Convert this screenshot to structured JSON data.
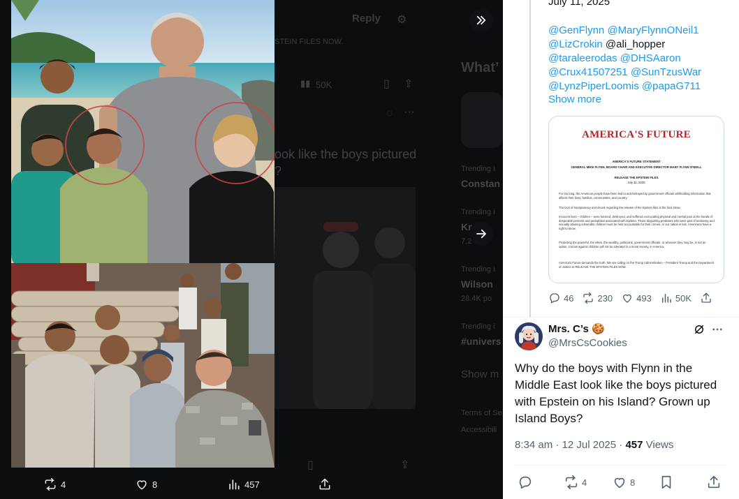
{
  "background": {
    "reply_button": "Reply",
    "epstein_text": "STEIN FILES NOW.",
    "views": "50K",
    "tweet_text_line1": "ook like the boys pictured",
    "tweet_text_line2": "?",
    "sidebar_heading": "What’",
    "trends": [
      {
        "context": "Trending i",
        "name": "Constan",
        "count": ""
      },
      {
        "context": "Trending i",
        "name": "Kr",
        "count": "7,2"
      },
      {
        "context": "Trending i",
        "name": "Wilson",
        "count": "28.4K po"
      },
      {
        "context": "Trending i",
        "name": "#univers",
        "count": ""
      }
    ],
    "show_more": "Show m",
    "footer1": "Terms of Se",
    "footer2": "Accessibili"
  },
  "media_actions": {
    "retweets": "4",
    "likes": "8",
    "views": "457"
  },
  "panel": {
    "date": "July 11, 2025",
    "mentions": [
      {
        "text": "@GenFlynn",
        "link": true
      },
      {
        "text": " ",
        "link": false
      },
      {
        "text": "@MaryFlynnONeil1",
        "link": true
      },
      {
        "text": " ",
        "link": false
      },
      {
        "text": "@LizCrokin",
        "link": true
      },
      {
        "text": " @ali_hopper ",
        "link": false
      },
      {
        "text": "@taraleerodas",
        "link": true
      },
      {
        "text": " ",
        "link": false
      },
      {
        "text": "@DHSAaron",
        "link": true
      },
      {
        "text": " ",
        "link": false
      },
      {
        "text": "@Crux41507251",
        "link": true
      },
      {
        "text": " ",
        "link": false
      },
      {
        "text": "@SunTzusWar",
        "link": true
      },
      {
        "text": " ",
        "link": false
      },
      {
        "text": "@LynzPiperLoomis",
        "link": true
      },
      {
        "text": " ",
        "link": false
      },
      {
        "text": "@papaG711",
        "link": true
      }
    ],
    "show_more": "Show more",
    "doc": {
      "title": "AMERICA'S FUTURE",
      "statement": "AMERICA'S FUTURE STATEMENT",
      "byline": "GENERAL MIKE FLYNN, BOARD CHAIR AND EXECUTIVE DIRECTOR MARY FLYNN O'NEILL",
      "headline": "RELEASE THE EPSTEIN FILES",
      "date": "July 11, 2025",
      "paragraphs": [
        "For too long, the American people have been lied to and betrayed by government officials withholding information that affects their lives, families, communities, and country.",
        "The lack of transparency and deceit regarding the release of the Epstein files is the final straw.",
        "Innocent lives – children – were harmed, destroyed, and suffered excruciating physical and mental pain at the hands of despicable perverts and pedophiles associated with Epstein. Those disgusting predators who were part of enslaving and sexually abusing vulnerable children must be held accountable for their crimes, or our nation is lost. Americans have a right to know.",
        "Protecting the powerful, the elites, the wealthy, politicians, government officials, or whoever they may be, is not an option. Crimes against children will not be tolerated in a moral society, in America.",
        "America's Future demands the truth. We are calling on the Trump Administration – President Trump and the Department of Justice to RELEASE THE EPSTEIN FILES NOW."
      ]
    },
    "stats": {
      "replies": "46",
      "retweets": "230",
      "likes": "493",
      "views": "50K"
    },
    "reply": {
      "name": "Mrs. C’s",
      "name_emoji": "🍪",
      "handle": "@MrsCsCookies",
      "text": "Why do the boys with Flynn in the Middle East look like the boys pictured with Epstein on his Island? Grown up Island Boys?",
      "time": "8:34 am · 12 Jul 2025 · ",
      "views_count": "457",
      "views_label": " Views",
      "retweets": "4",
      "likes": "8"
    }
  },
  "colors": {
    "accent": "#1d9bf0",
    "text_primary": "#0f1419",
    "text_secondary": "#536471",
    "doc_title_red": "#b0262d"
  },
  "icons": [
    "collapse-icon",
    "next-arrow-icon",
    "retweet-icon",
    "heart-icon",
    "views-icon",
    "share-icon",
    "reply-icon",
    "bookmark-icon",
    "grok-icon",
    "more-icon"
  ]
}
